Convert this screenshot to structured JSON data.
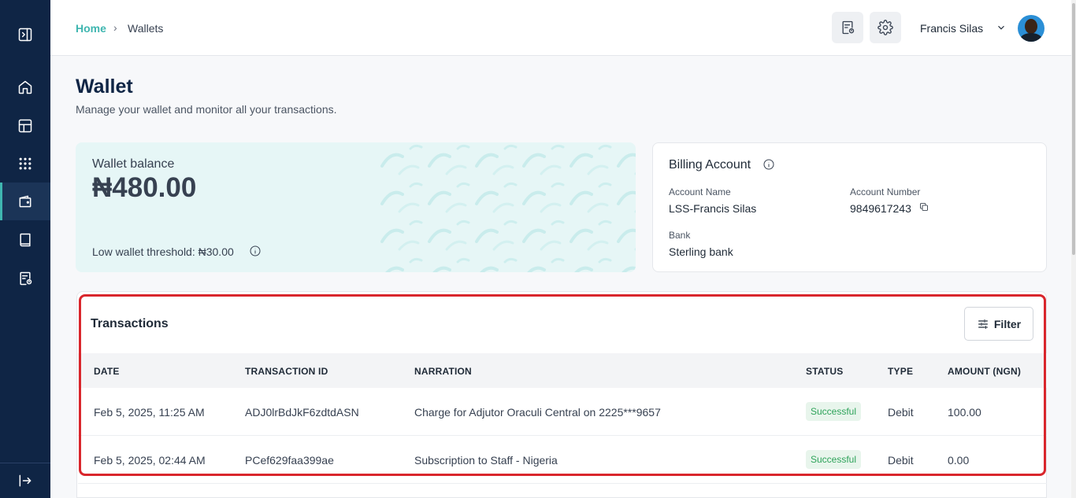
{
  "breadcrumb": {
    "home": "Home",
    "separator": "›",
    "current": "Wallets"
  },
  "user": {
    "name": "Francis Silas"
  },
  "page": {
    "title": "Wallet",
    "subtitle": "Manage your wallet and monitor all your transactions."
  },
  "wallet": {
    "label": "Wallet balance",
    "amount": "₦480.00",
    "threshold": "Low wallet threshold: ₦30.00"
  },
  "billing": {
    "title": "Billing Account",
    "account_name_label": "Account Name",
    "account_name": "LSS-Francis Silas",
    "account_number_label": "Account Number",
    "account_number": "9849617243",
    "bank_label": "Bank",
    "bank": "Sterling bank"
  },
  "transactions": {
    "title": "Transactions",
    "filter_label": "Filter",
    "columns": [
      "DATE",
      "TRANSACTION ID",
      "NARRATION",
      "STATUS",
      "TYPE",
      "AMOUNT (NGN)"
    ],
    "rows": [
      {
        "date": "Feb 5, 2025, 11:25 AM",
        "id": "ADJ0lrBdJkF6zdtdASN",
        "narration": "Charge for Adjutor Oraculi Central on 2225***9657",
        "status": "Successful",
        "type": "Debit",
        "amount": "100.00"
      },
      {
        "date": "Feb 5, 2025, 02:44 AM",
        "id": "PCef629faa399ae",
        "narration": "Subscription to Staff - Nigeria",
        "status": "Successful",
        "type": "Debit",
        "amount": "0.00"
      }
    ]
  },
  "colors": {
    "sidebar": "#0f2545",
    "accent": "#3fb6b0",
    "highlight": "#d9262c",
    "success": "#2ea35a"
  }
}
